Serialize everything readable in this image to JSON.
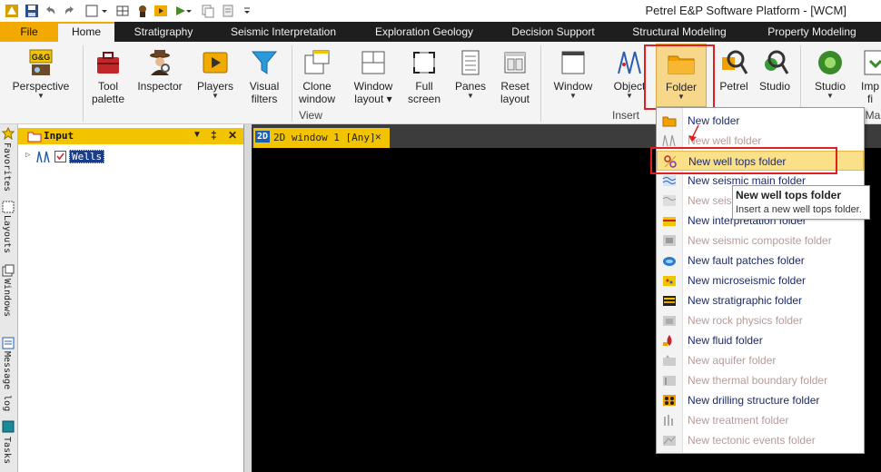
{
  "window": {
    "title": "Petrel E&P Software Platform - [WCM]"
  },
  "tabs": [
    {
      "label": "File"
    },
    {
      "label": "Home"
    },
    {
      "label": "Stratigraphy"
    },
    {
      "label": "Seismic Interpretation"
    },
    {
      "label": "Exploration Geology"
    },
    {
      "label": "Decision Support"
    },
    {
      "label": "Structural Modeling"
    },
    {
      "label": "Property Modeling"
    }
  ],
  "ribbon": {
    "perspective": {
      "label": "Perspective",
      "badge": "G&G"
    },
    "tool_palette": {
      "line1": "Tool",
      "line2": "palette"
    },
    "inspector": {
      "label": "Inspector"
    },
    "players": {
      "label": "Players"
    },
    "visual_filters": {
      "line1": "Visual",
      "line2": "filters"
    },
    "clone_window": {
      "line1": "Clone",
      "line2": "window"
    },
    "window_layout": {
      "line1": "Window",
      "line2": "layout ▾"
    },
    "full_screen": {
      "line1": "Full",
      "line2": "screen"
    },
    "panes": {
      "label": "Panes"
    },
    "reset_layout": {
      "line1": "Reset",
      "line2": "layout"
    },
    "window": {
      "label": "Window"
    },
    "object": {
      "label": "Object"
    },
    "folder": {
      "label": "Folder"
    },
    "petrel": {
      "label": "Petrel"
    },
    "studio": {
      "label": "Studio"
    },
    "studio2": {
      "label": "Studio"
    },
    "import": {
      "line1": "Imp",
      "line2": "fi"
    },
    "groups": {
      "view": "View",
      "insert": "Insert",
      "ma": "Ma"
    }
  },
  "side_strip": [
    "Favorites",
    "Layouts",
    "Windows",
    "Message log",
    "Tasks"
  ],
  "input_panel": {
    "title": "Input",
    "pin": "‡",
    "close": "✕",
    "tree": [
      {
        "label": "Wells"
      }
    ]
  },
  "document": {
    "tab_badge": "2D",
    "tab_label": "2D window 1 [Any]",
    "tab_close": "✕"
  },
  "folder_menu": {
    "items": [
      {
        "label": "New folder",
        "enabled": true,
        "icon": "folder-icon"
      },
      {
        "label": "New well folder",
        "enabled": false,
        "icon": "well-folder-icon"
      },
      {
        "label": "New well tops folder",
        "enabled": true,
        "icon": "well-tops-folder-icon",
        "selected": true
      },
      {
        "label": "New seismic main folder",
        "enabled": true,
        "icon": "seismic-main-folder-icon"
      },
      {
        "label": "New seis",
        "enabled": false,
        "icon": "seismic-folder-icon"
      },
      {
        "label": "New interpretation folder",
        "enabled": true,
        "icon": "interpretation-folder-icon"
      },
      {
        "label": "New seismic composite folder",
        "enabled": false,
        "icon": "seismic-composite-folder-icon"
      },
      {
        "label": "New fault patches folder",
        "enabled": true,
        "icon": "fault-patches-folder-icon"
      },
      {
        "label": "New microseismic folder",
        "enabled": true,
        "icon": "microseismic-folder-icon"
      },
      {
        "label": "New stratigraphic folder",
        "enabled": true,
        "icon": "stratigraphic-folder-icon"
      },
      {
        "label": "New rock physics folder",
        "enabled": false,
        "icon": "rock-physics-folder-icon"
      },
      {
        "label": "New fluid folder",
        "enabled": true,
        "icon": "fluid-folder-icon"
      },
      {
        "label": "New aquifer folder",
        "enabled": false,
        "icon": "aquifer-folder-icon"
      },
      {
        "label": "New thermal boundary folder",
        "enabled": false,
        "icon": "thermal-boundary-folder-icon"
      },
      {
        "label": "New drilling structure folder",
        "enabled": true,
        "icon": "drilling-structure-folder-icon"
      },
      {
        "label": "New treatment folder",
        "enabled": false,
        "icon": "treatment-folder-icon"
      },
      {
        "label": "New tectonic events folder",
        "enabled": false,
        "icon": "tectonic-events-folder-icon"
      }
    ]
  },
  "tooltip": {
    "title": "New well tops folder",
    "text": "Insert a new well tops folder."
  },
  "colors": {
    "accent": "#f2c300",
    "file_tab": "#f2a900",
    "highlight_red": "#e02020",
    "menu_enabled_text": "#1b2a6b",
    "menu_disabled_text": "#b89a9a"
  }
}
